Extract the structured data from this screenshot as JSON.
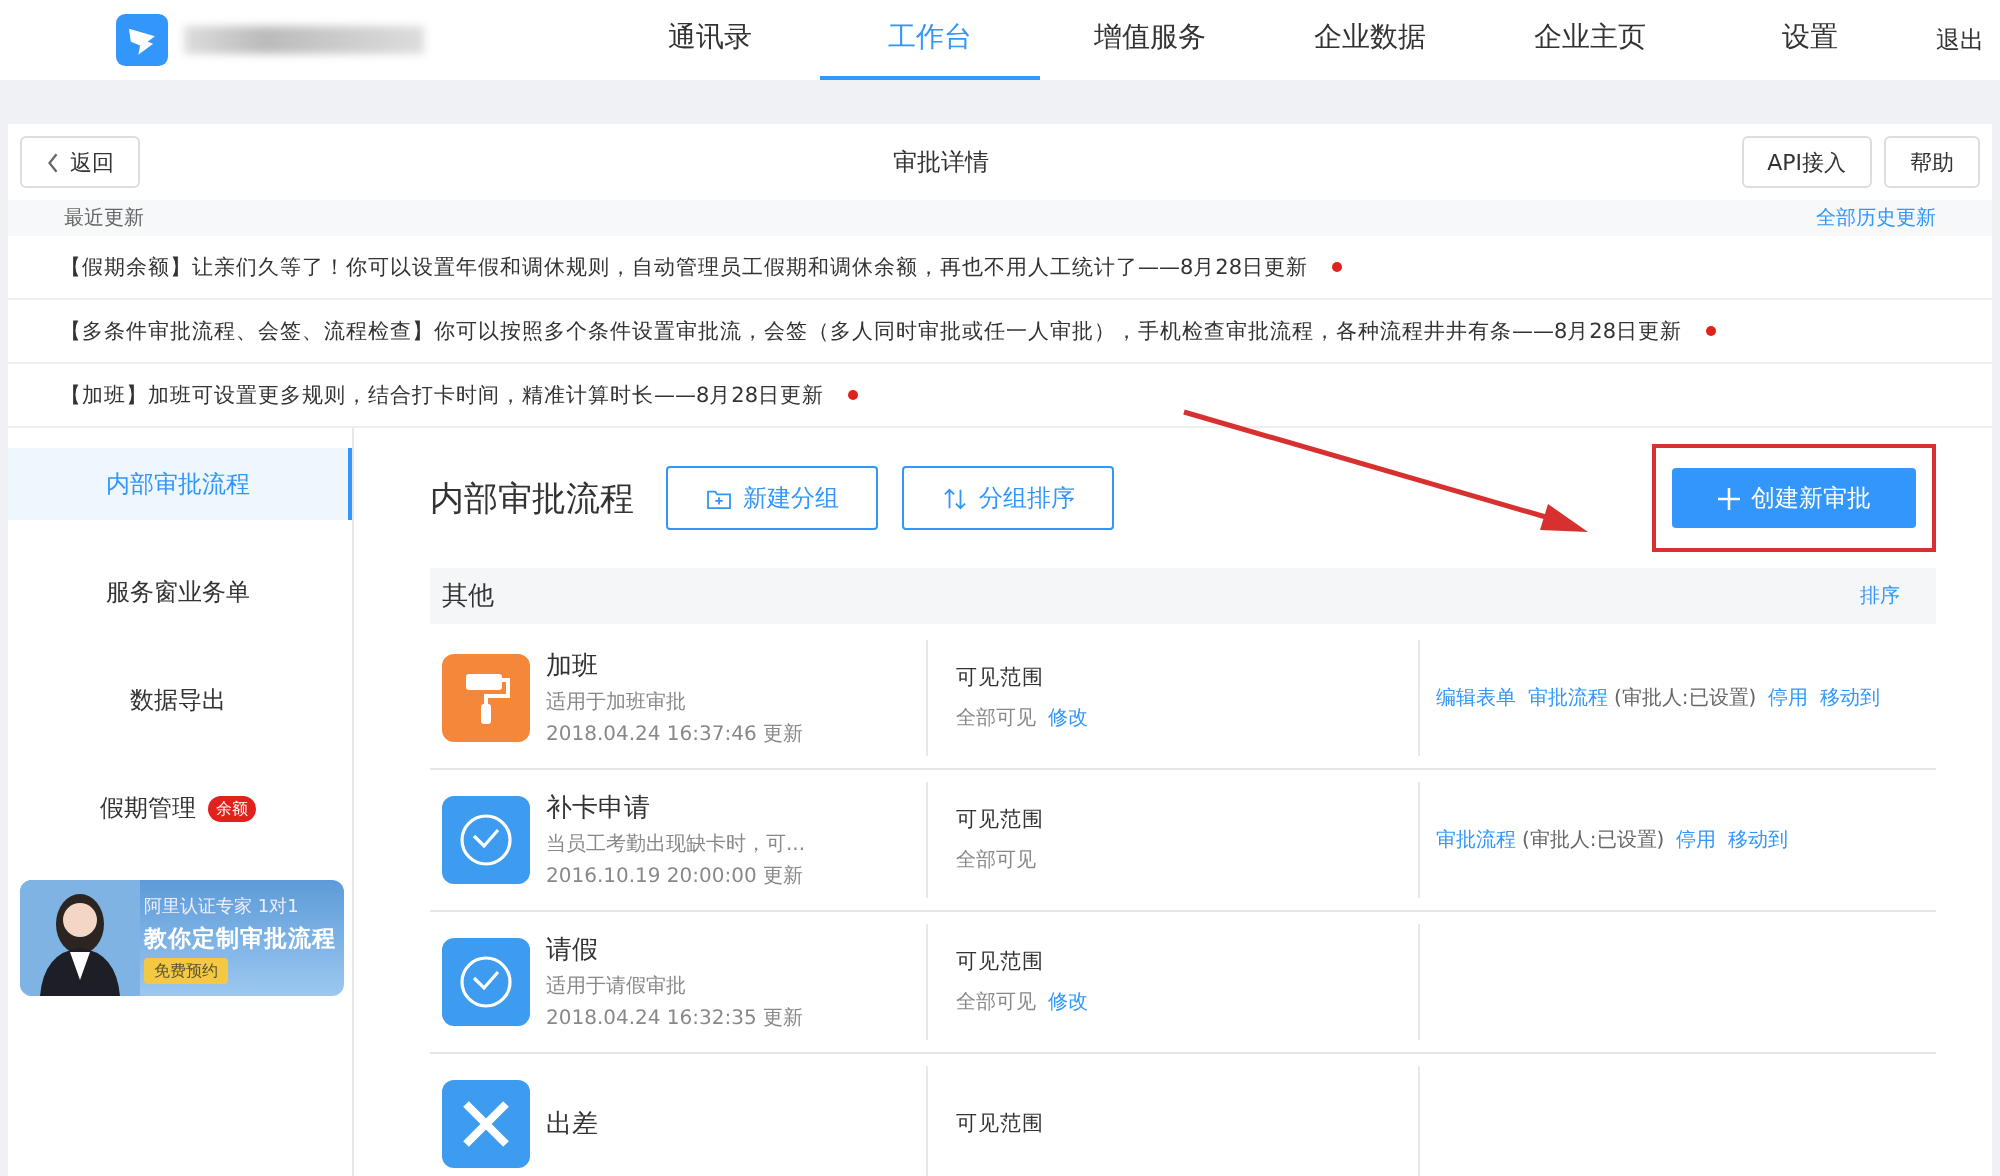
{
  "nav": {
    "items": [
      {
        "label": "通讯录",
        "selected": false
      },
      {
        "label": "工作台",
        "selected": true
      },
      {
        "label": "增值服务",
        "selected": false
      },
      {
        "label": "企业数据",
        "selected": false
      },
      {
        "label": "企业主页",
        "selected": false
      },
      {
        "label": "设置",
        "selected": false
      }
    ],
    "logout": "退出"
  },
  "header": {
    "back": "返回",
    "title": "审批详情",
    "buttons": [
      "API接入",
      "帮助"
    ]
  },
  "updates": {
    "label": "最近更新",
    "history_link": "全部历史更新",
    "items": [
      {
        "text": "【假期余额】让亲们久等了！你可以设置年假和调休规则，自动管理员工假期和调休余额，再也不用人工统计了——8月28日更新",
        "unread": true
      },
      {
        "text": "【多条件审批流程、会签、流程检查】你可以按照多个条件设置审批流，会签（多人同时审批或任一人审批），手机检查审批流程，各种流程井井有条——8月28日更新",
        "unread": true
      },
      {
        "text": "【加班】加班可设置更多规则，结合打卡时间，精准计算时长——8月28日更新",
        "unread": true
      }
    ]
  },
  "sidebar": {
    "items": [
      {
        "label": "内部审批流程",
        "selected": true
      },
      {
        "label": "服务窗业务单",
        "selected": false
      },
      {
        "label": "数据导出",
        "selected": false
      },
      {
        "label": "假期管理",
        "selected": false,
        "badge": "余额"
      }
    ],
    "banner": {
      "line1": "阿里认证专家 1对1",
      "line2": "教你定制审批流程",
      "button": "免费预约"
    }
  },
  "main": {
    "title": "内部审批流程",
    "buttons": [
      {
        "label": "新建分组",
        "kind": "folder"
      },
      {
        "label": "分组排序",
        "kind": "sort"
      }
    ],
    "create_button": "创建新审批",
    "create_highlighted": true,
    "annotation_arrow": true,
    "group": {
      "name": "其他",
      "sort_link": "排序",
      "rows": [
        {
          "title": "加班",
          "kind": "brush",
          "color": "#f5873a",
          "description": "适用于加班审批",
          "updated": "2018.04.24 16:37:46 更新",
          "scope_label": "可见范围",
          "scope": "全部可见",
          "scope_link": "修改",
          "actions": [
            {
              "kind": "link",
              "text": "编辑表单"
            },
            {
              "kind": "link",
              "text": "审批流程"
            },
            {
              "kind": "note",
              "text": "(审批人:已设置)"
            },
            {
              "kind": "link",
              "text": "停用"
            },
            {
              "kind": "link",
              "text": "移动到"
            }
          ]
        },
        {
          "title": "补卡申请",
          "kind": "clock",
          "color": "#3d9bf0",
          "description": "当员工考勤出现缺卡时，可...",
          "updated": "2016.10.19 20:00:00 更新",
          "scope_label": "可见范围",
          "scope": "全部可见",
          "actions": [
            {
              "kind": "link",
              "text": "审批流程"
            },
            {
              "kind": "note",
              "text": "(审批人:已设置)"
            },
            {
              "kind": "link",
              "text": "停用"
            },
            {
              "kind": "link",
              "text": "移动到"
            }
          ]
        },
        {
          "title": "请假",
          "kind": "clock",
          "color": "#3d9bf0",
          "description": "适用于请假审批",
          "updated": "2018.04.24 16:32:35 更新",
          "scope_label": "可见范围",
          "scope": "全部可见",
          "scope_link": "修改"
        },
        {
          "title": "出差",
          "kind": "wrench",
          "color": "#3d9bf0",
          "scope_label": "可见范围"
        }
      ]
    }
  }
}
